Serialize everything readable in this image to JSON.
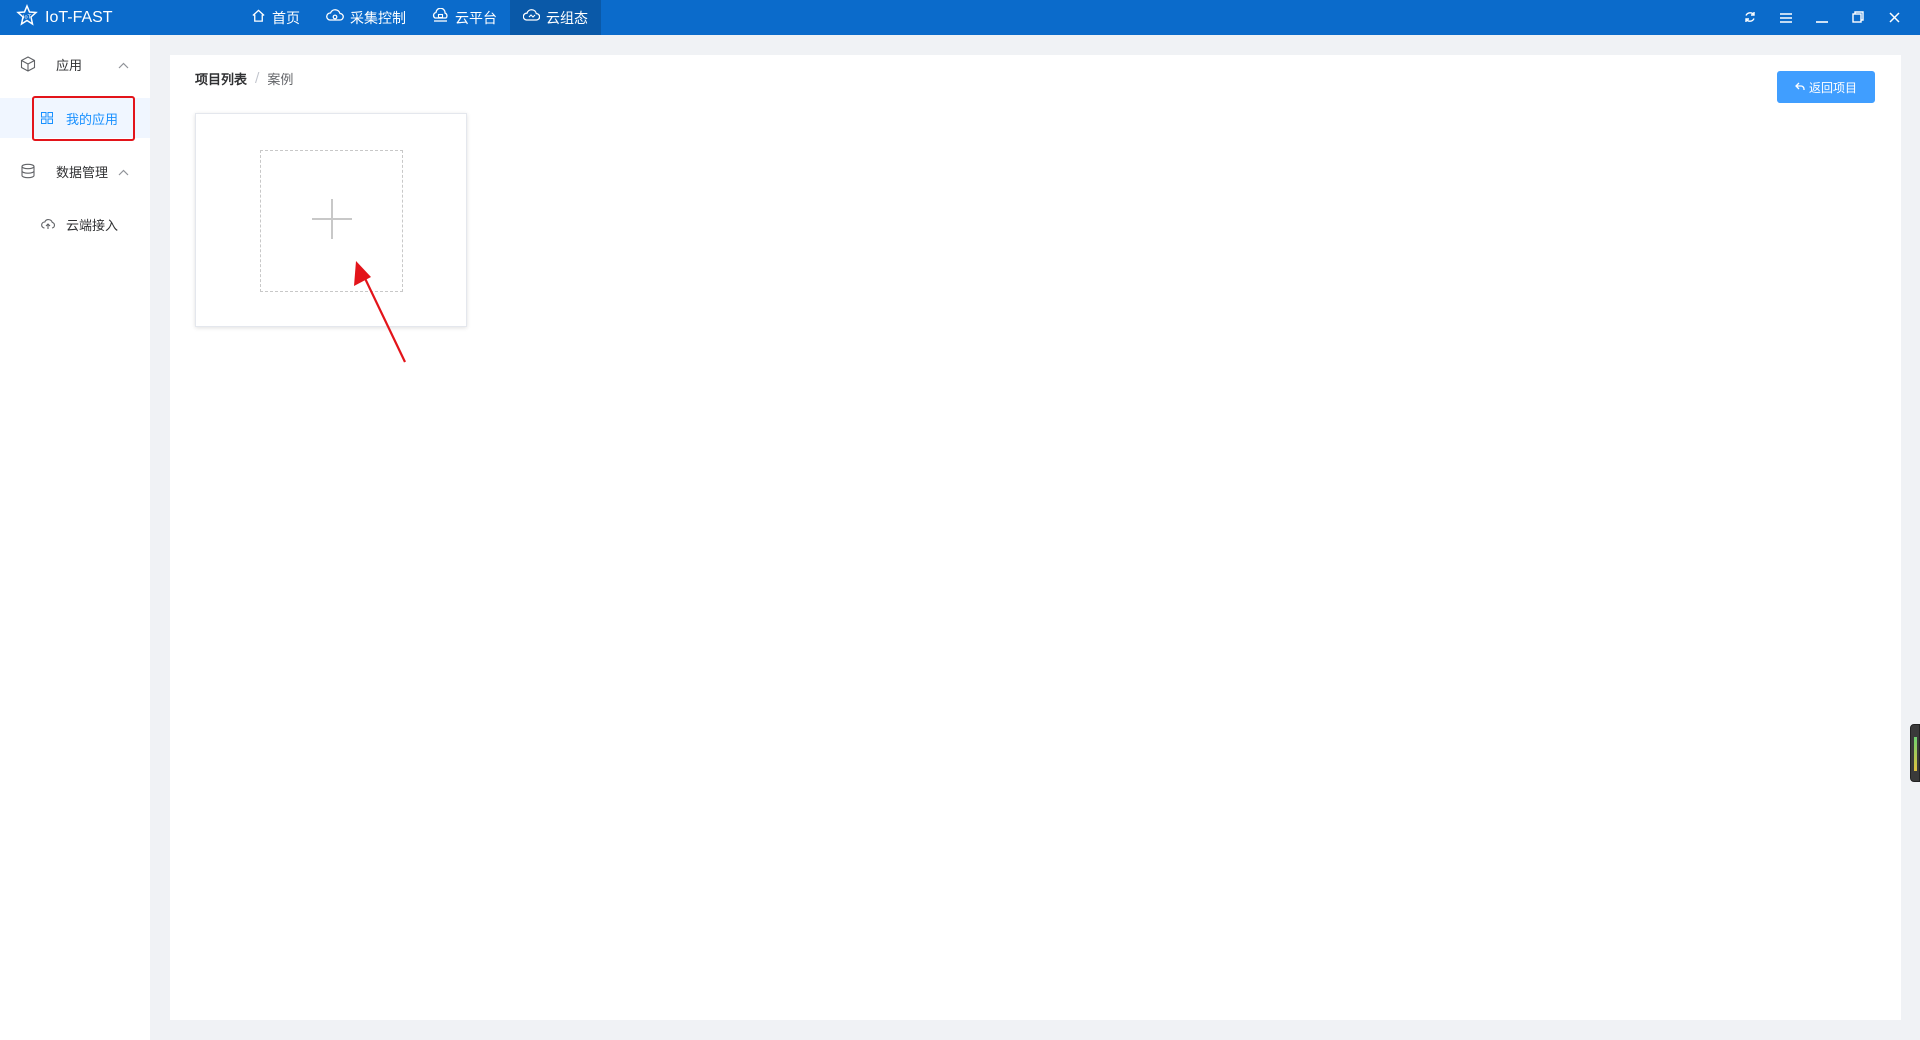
{
  "app": {
    "title": "IoT-FAST",
    "logo_text": "IoT"
  },
  "nav": {
    "items": [
      {
        "label": "首页",
        "icon": "home-icon"
      },
      {
        "label": "采集控制",
        "icon": "cloud-gear-icon"
      },
      {
        "label": "云平台",
        "icon": "cloud-platform-icon"
      },
      {
        "label": "云组态",
        "icon": "cloud-config-icon",
        "active": true
      }
    ]
  },
  "window_controls": [
    "refresh-icon",
    "menu-icon",
    "minimize-icon",
    "restore-icon",
    "close-icon"
  ],
  "sidebar": {
    "groups": [
      {
        "label": "应用",
        "icon": "cube-icon",
        "expanded": true,
        "items": [
          {
            "label": "我的应用",
            "icon": "grid-icon",
            "active": true
          }
        ]
      },
      {
        "label": "数据管理",
        "icon": "database-icon",
        "expanded": true,
        "items": [
          {
            "label": "云端接入",
            "icon": "cloud-upload-icon"
          }
        ]
      }
    ]
  },
  "main": {
    "breadcrumb": {
      "parent": "项目列表",
      "separator": "/",
      "current": "案例"
    },
    "back_button": "返回项目",
    "add_card_icon": "plus-icon"
  },
  "colors": {
    "topbar": "#0b6bcb",
    "topbar_active": "#0a59a8",
    "primary": "#409eff",
    "sidebar_active_text": "#1890ff",
    "annotation": "#e3141a"
  }
}
